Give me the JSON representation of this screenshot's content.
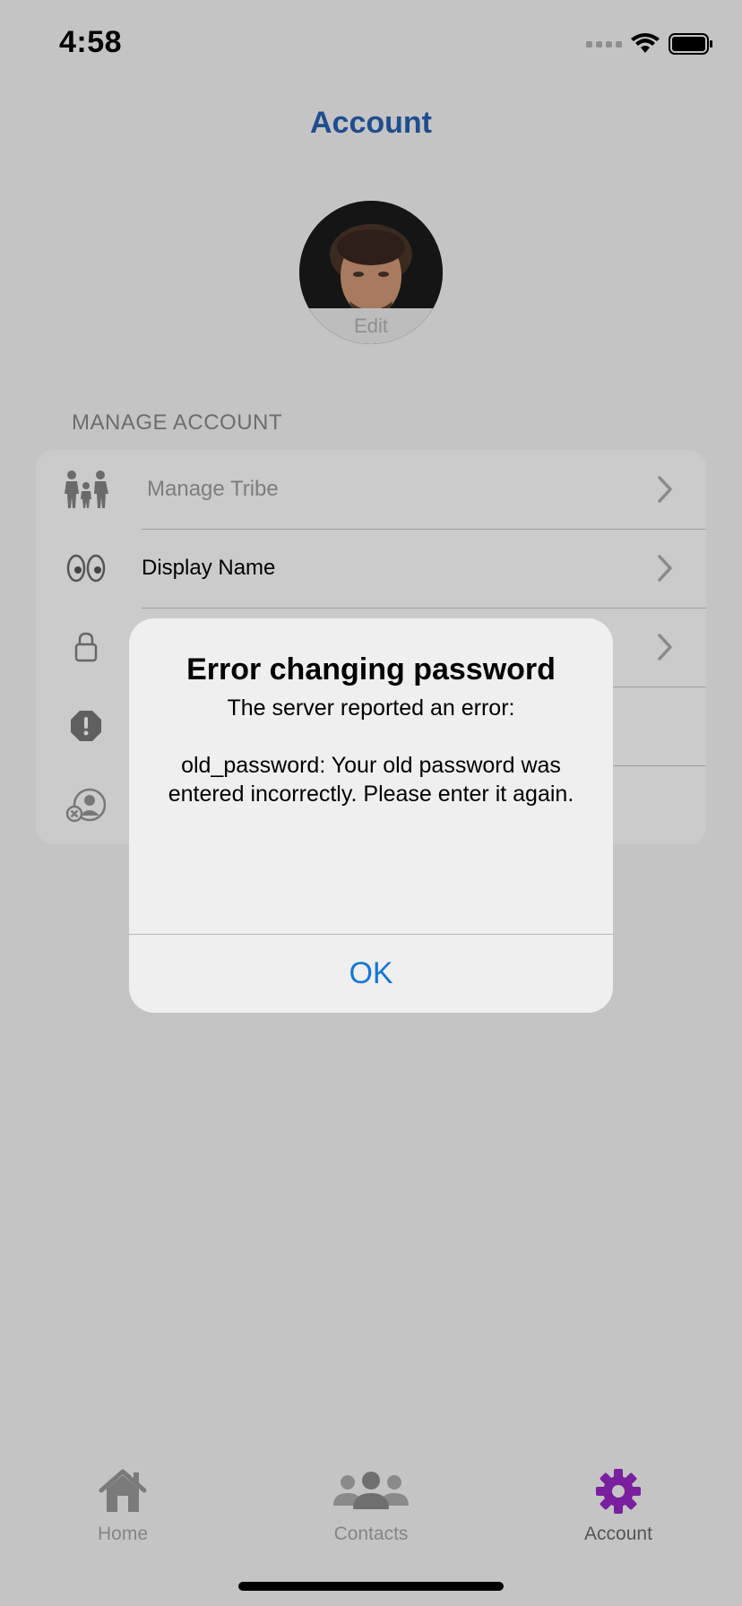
{
  "status": {
    "time": "4:58"
  },
  "nav": {
    "title": "Account"
  },
  "avatar": {
    "edit_label": "Edit"
  },
  "section": {
    "header": "MANAGE ACCOUNT"
  },
  "rows": [
    {
      "label": "Manage Tribe",
      "icon": "family-icon"
    },
    {
      "label": "Display Name",
      "icon": "eyes-icon"
    },
    {
      "label": "",
      "icon": "lock-icon"
    },
    {
      "label": "",
      "icon": "warning-octagon-icon"
    },
    {
      "label": "",
      "icon": "remove-user-icon"
    }
  ],
  "alert": {
    "title": "Error changing password",
    "message": "The server reported an error:\n\nold_password: Your old password was entered incorrectly. Please enter it again.",
    "ok_label": "OK"
  },
  "tabs": [
    {
      "label": "Home",
      "icon": "home-icon"
    },
    {
      "label": "Contacts",
      "icon": "contacts-icon"
    },
    {
      "label": "Account",
      "icon": "gear-icon"
    }
  ],
  "colors": {
    "title_blue": "#1f4d8e",
    "alert_button_blue": "#1477d6",
    "active_tab_purple": "#7a1f9e"
  }
}
